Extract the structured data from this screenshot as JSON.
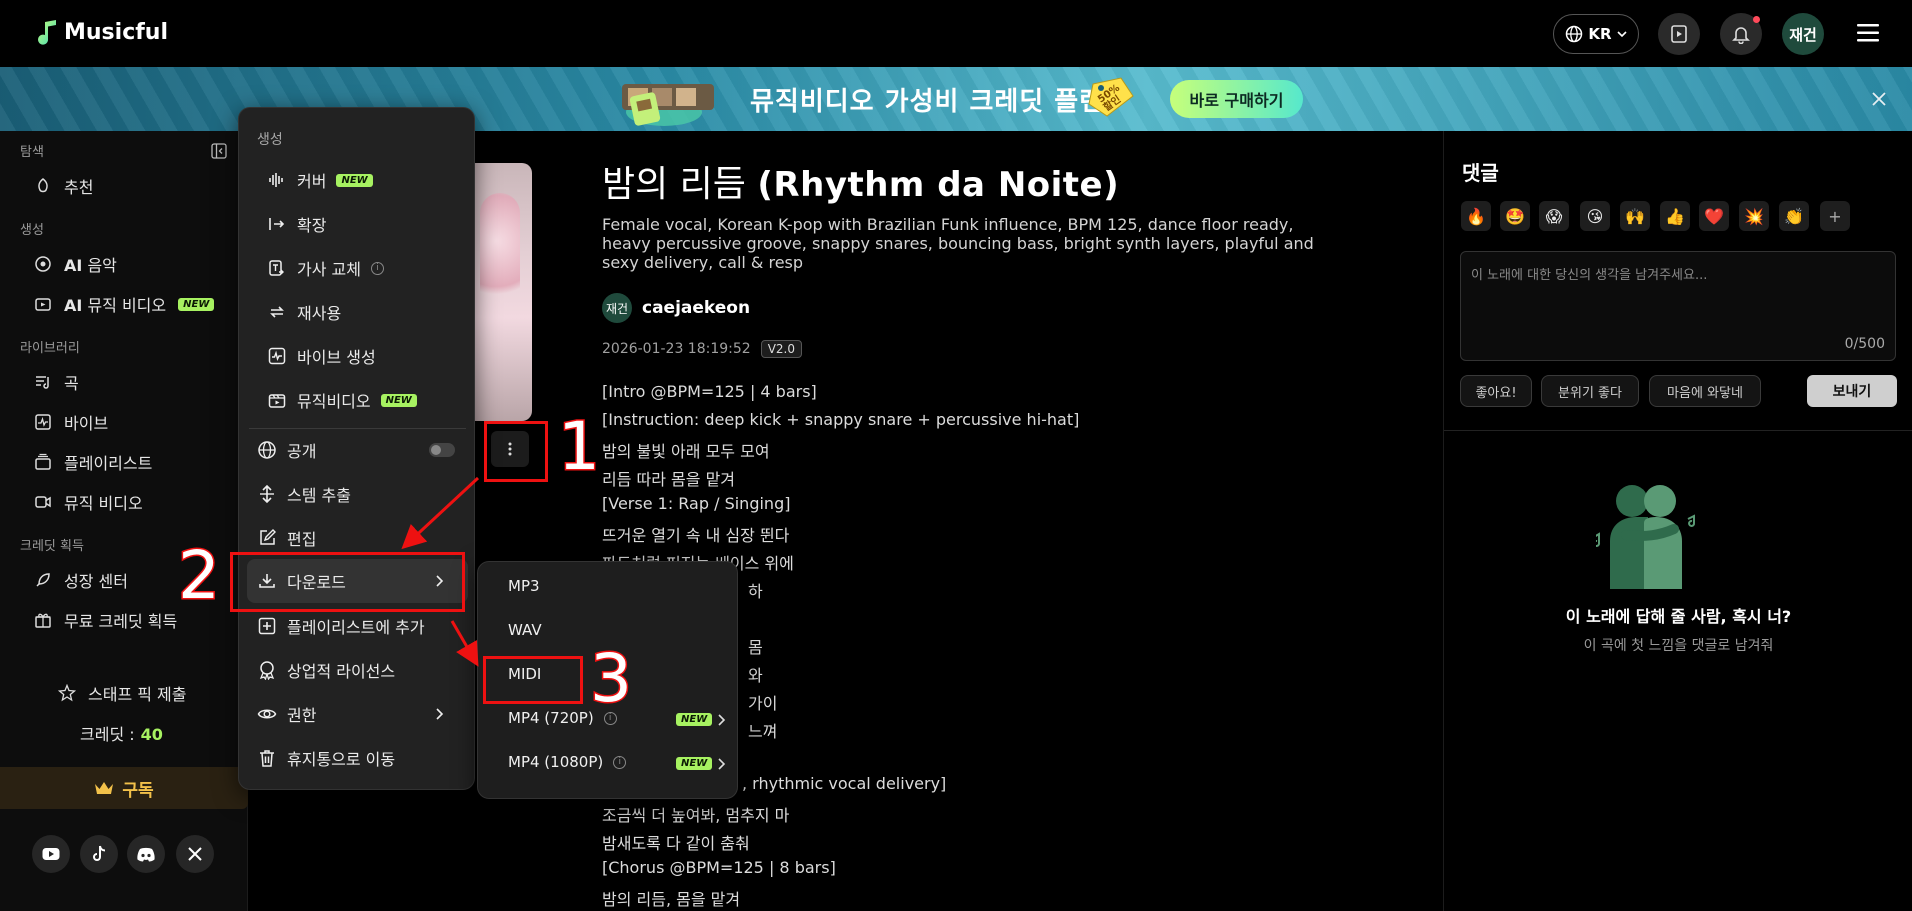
{
  "header": {
    "logo_text": "Musicful",
    "lang_label": "KR",
    "avatar_label": "재건"
  },
  "banner": {
    "text": "뮤직비디오 가성비 크레딧 플랜",
    "tag_text": "50% 할인",
    "cta_label": "바로 구매하기"
  },
  "sidebar": {
    "sections": [
      {
        "title": "탐색",
        "items": [
          {
            "label": "추천",
            "icon": "compass-icon"
          }
        ]
      },
      {
        "title": "생성",
        "items": [
          {
            "label": "AI 음악",
            "icon": "ai-music-icon"
          },
          {
            "label": "AI 뮤직 비디오",
            "icon": "ai-video-icon",
            "badge": "NEW"
          }
        ]
      },
      {
        "title": "라이브러리",
        "items": [
          {
            "label": "곡",
            "icon": "songs-icon"
          },
          {
            "label": "바이브",
            "icon": "vibe-icon"
          },
          {
            "label": "플레이리스트",
            "icon": "playlist-icon"
          },
          {
            "label": "뮤직 비디오",
            "icon": "video-icon"
          }
        ]
      },
      {
        "title": "크레딧 획득",
        "items": [
          {
            "label": "성장 센터",
            "icon": "rocket-icon"
          },
          {
            "label": "무료 크레딧 획득",
            "icon": "gift-icon"
          }
        ]
      }
    ],
    "staff_pick_label": "스태프 픽 제출",
    "credit_label": "크레딧 :",
    "credit_value": "40",
    "subscribe_label": "구독"
  },
  "song": {
    "title_ko": "밤의 리듬",
    "title_en": "(Rhythm da Noite)",
    "description": "Female vocal, Korean K-pop with Brazilian Funk influence, BPM 125, dance floor ready, heavy percussive groove, snappy snares, bouncing bass, bright synth layers, playful and sexy delivery, call & resp",
    "author_avatar": "재건",
    "author_name": "caejaekeon",
    "date": "2026-01-23 18:19:52",
    "version": "V2.0",
    "lyrics": [
      "[Intro @BPM=125 | 4 bars]",
      "[Instruction: deep kick + snappy snare + percussive hi-hat]",
      "밤의 불빛 아래 모두 모여",
      "리듬 따라 몸을 맡겨",
      "[Verse 1: Rap / Singing]",
      "뜨거운 열기 속 내 심장 뛴다",
      "파도처럼 퍼지는 베이스 위에",
      "하",
      "",
      "몸",
      "와",
      "가이",
      "느껴",
      ", rhythmic vocal delivery]",
      "조금씩 더 높여봐, 멈추지 마",
      "밤새도록 다 같이 춤춰",
      "[Chorus @BPM=125 | 8 bars]",
      "밤의 리듬, 몸을 맡겨"
    ]
  },
  "context_menu": {
    "section_create": "생성",
    "items_create": [
      {
        "label": "커버",
        "icon": "waveform-icon",
        "badge": "NEW"
      },
      {
        "label": "확장",
        "icon": "extend-icon"
      },
      {
        "label": "가사 교체",
        "icon": "lyrics-replace-icon",
        "info": "i"
      },
      {
        "label": "재사용",
        "icon": "reuse-icon"
      },
      {
        "label": "바이브 생성",
        "icon": "vibe-create-icon"
      },
      {
        "label": "뮤직비디오",
        "icon": "music-video-icon",
        "badge": "NEW"
      }
    ],
    "items_main": [
      {
        "label": "공개",
        "icon": "globe-icon"
      },
      {
        "label": "스템 추출",
        "icon": "stem-icon"
      },
      {
        "label": "편집",
        "icon": "edit-icon"
      },
      {
        "label": "다운로드",
        "icon": "download-icon"
      },
      {
        "label": "플레이리스트에 추가",
        "icon": "add-playlist-icon"
      },
      {
        "label": "상업적 라이선스",
        "icon": "license-icon"
      },
      {
        "label": "권한",
        "icon": "eye-icon"
      },
      {
        "label": "휴지통으로 이동",
        "icon": "trash-icon"
      }
    ]
  },
  "download_menu": {
    "items": [
      {
        "label": "MP3"
      },
      {
        "label": "WAV"
      },
      {
        "label": "MIDI"
      },
      {
        "label": "MP4 (720P)",
        "info": "i",
        "badge": "NEW"
      },
      {
        "label": "MP4 (1080P)",
        "info": "i",
        "badge": "NEW"
      }
    ]
  },
  "comments": {
    "title": "댓글",
    "emojis": [
      "🔥",
      "🤩",
      "😱",
      "😘",
      "🙌",
      "👍",
      "❤️",
      "💥",
      "👏",
      "+"
    ],
    "placeholder": "이 노래에 대한 당신의 생각을 남겨주세요...",
    "count": "0/500",
    "chips": [
      "좋아요!",
      "분위기 좋다",
      "마음에 와닿네"
    ],
    "send_label": "보내기",
    "empty_title": "이 노래에 답해 줄 사람, 혹시 너?",
    "empty_sub": "이 곡에 첫 느낌을 댓글로 남겨줘"
  },
  "annotations": {
    "num1": "1",
    "num2": "2",
    "num3": "3",
    "color": "#e11111"
  }
}
